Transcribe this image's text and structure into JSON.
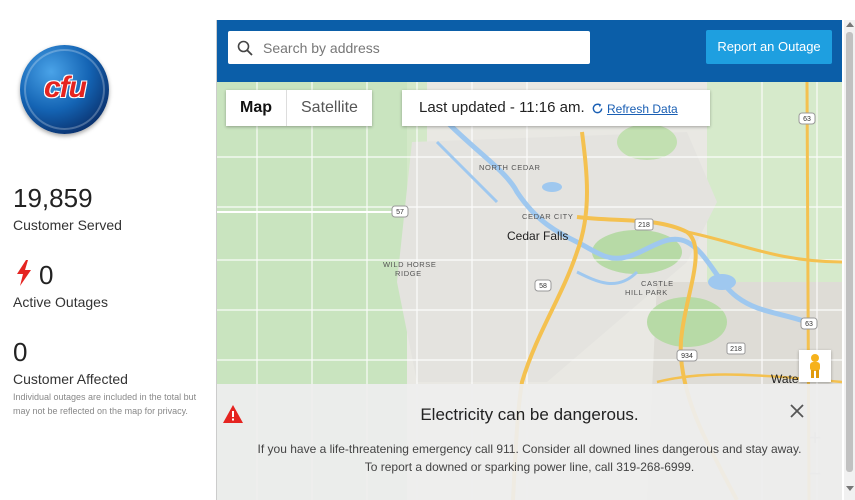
{
  "brand": {
    "logo_text": "cfu"
  },
  "stats": {
    "customers_served": {
      "value": "19,859",
      "label": "Customer Served"
    },
    "active_outages": {
      "value": "0",
      "label": "Active Outages"
    },
    "customers_affected": {
      "value": "0",
      "label": "Customer Affected",
      "note": "Individual outages are included in the total but may not be reflected on the map for privacy."
    }
  },
  "header": {
    "search_placeholder": "Search by address",
    "report_button": "Report an Outage"
  },
  "map_controls": {
    "map_label": "Map",
    "satellite_label": "Satellite",
    "last_updated": "Last updated - 11:16 am.",
    "refresh_label": "Refresh Data"
  },
  "map_labels": {
    "north_cedar": "NORTH CEDAR",
    "cedar_city": "CEDAR CITY",
    "cedar_falls": "Cedar Falls",
    "wild_horse_1": "WILD HORSE",
    "wild_horse_2": "RIDGE",
    "castle_1": "CASTLE",
    "castle_2": "HILL PARK",
    "waterloo": "Wate",
    "r63a": "63",
    "r57": "57",
    "r218a": "218",
    "r58": "58",
    "r63b": "63",
    "r934": "934",
    "r218b": "218"
  },
  "banner": {
    "title": "Electricity can be dangerous.",
    "body": "If you have a life-threatening emergency call 911. Consider all downed lines dangerous and stay away. To report a downed or sparking power line, call 319-268-6999."
  },
  "colors": {
    "header_blue": "#0b5ea8",
    "button_blue": "#1e9fe0",
    "outage_red": "#e52420",
    "link_blue": "#1a5fb4"
  }
}
